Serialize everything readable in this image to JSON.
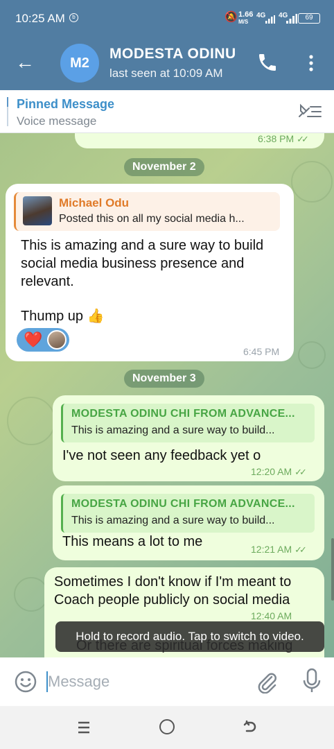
{
  "status_bar": {
    "time": "10:25 AM",
    "net_speed": "1.66",
    "net_unit": "M/S",
    "signal1": "4G",
    "signal2": "4G",
    "battery": "69"
  },
  "header": {
    "avatar_initials": "M2",
    "contact_name": "MODESTA ODINU",
    "last_seen": "last seen at 10:09 AM",
    "accent_color": "#517da2"
  },
  "pinned": {
    "title": "Pinned Message",
    "subtitle": "Voice message"
  },
  "chat": {
    "top_partial_message": {
      "time": "6:38 PM"
    },
    "date_separators": [
      "November 2",
      "November 3"
    ],
    "messages": [
      {
        "direction": "incoming",
        "reply_author": "Michael Odu",
        "reply_preview": "Posted this on all my social media h...",
        "text_lines": [
          "This is amazing and a sure way to build",
          "social media business presence and",
          "relevant.",
          "",
          "Thump up 👍"
        ],
        "reaction": "❤️",
        "time": "6:45 PM"
      },
      {
        "direction": "outgoing",
        "reply_author": "MODESTA ODINU CHI FROM ADVANCE...",
        "reply_preview": "This is amazing and a sure way to build...",
        "text": "I've not seen any feedback yet o",
        "time": "12:20 AM"
      },
      {
        "direction": "outgoing",
        "reply_author": "MODESTA ODINU CHI FROM ADVANCE...",
        "reply_preview": "This is amazing and a sure way to build...",
        "text": "This means a lot to me",
        "time": "12:21 AM"
      },
      {
        "direction": "outgoing",
        "text_lines": [
          "Sometimes I don't know if I'm meant to",
          "Coach people publicly on social media"
        ],
        "time": "12:40 AM",
        "partial_next_line": "Or there are spiritual forces making"
      }
    ],
    "tooltip": "Hold to record audio. Tap to switch to video."
  },
  "input": {
    "placeholder": "Message"
  }
}
